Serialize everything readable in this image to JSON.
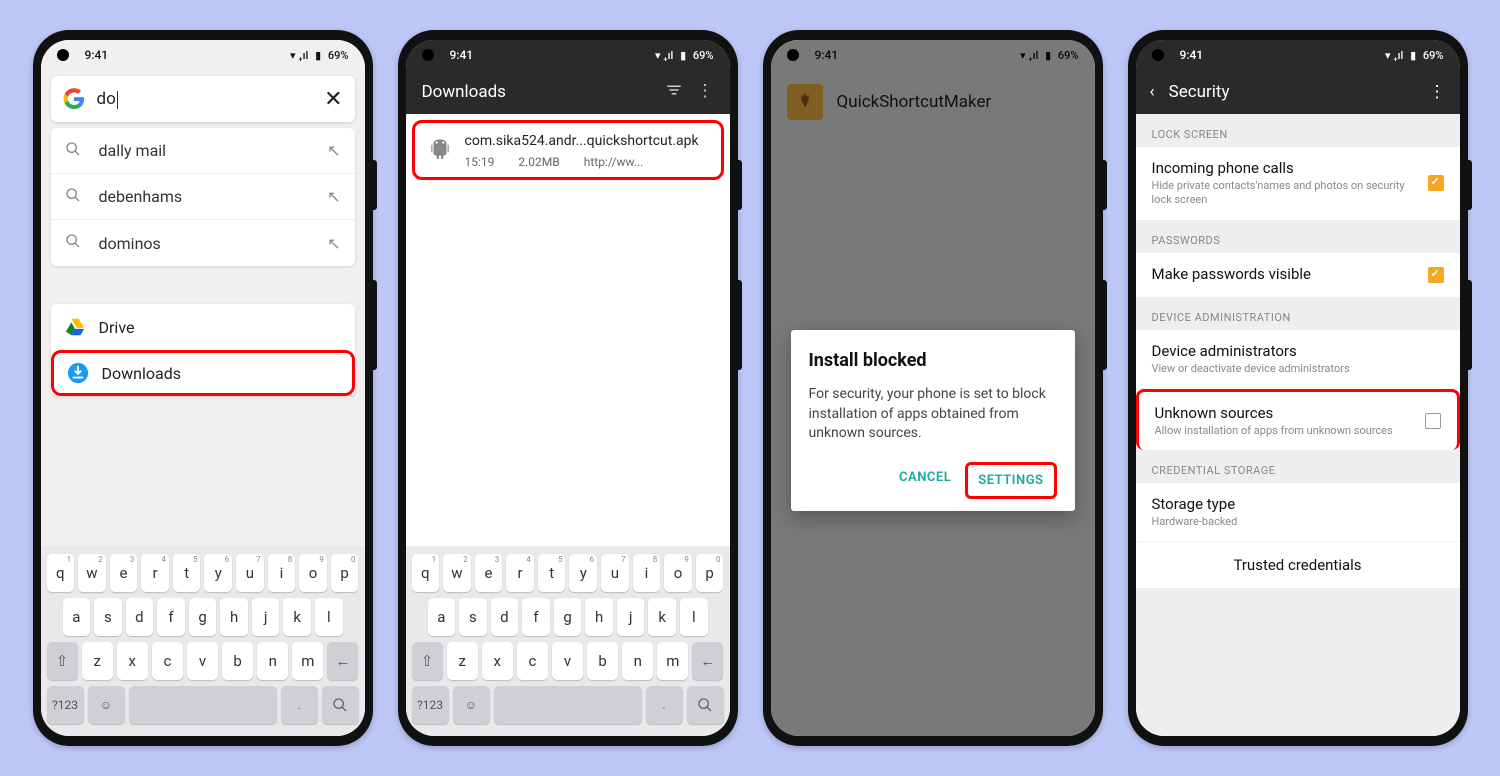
{
  "status": {
    "time": "9:41",
    "battery": "69%"
  },
  "phone1": {
    "search_query": "do",
    "suggestions": [
      {
        "text": "dally mail"
      },
      {
        "text": "debenhams"
      },
      {
        "text": "dominos"
      }
    ],
    "apps": {
      "drive": "Drive",
      "downloads": "Downloads"
    }
  },
  "keyboard": {
    "row1": [
      "q",
      "w",
      "e",
      "r",
      "t",
      "y",
      "u",
      "i",
      "o",
      "p"
    ],
    "row1sup": [
      "1",
      "2",
      "3",
      "4",
      "5",
      "6",
      "7",
      "8",
      "9",
      "0"
    ],
    "row2": [
      "a",
      "s",
      "d",
      "f",
      "g",
      "h",
      "j",
      "k",
      "l"
    ],
    "row3": [
      "z",
      "x",
      "c",
      "v",
      "b",
      "n",
      "m"
    ],
    "numkey": "?123"
  },
  "phone2": {
    "title": "Downloads",
    "file": {
      "name": "com.sika524.andr...quickshortcut.apk",
      "time": "15:19",
      "size": "2.02MB",
      "source": "http://ww..."
    }
  },
  "phone3": {
    "app_name": "QuickShortcutMaker",
    "dialog": {
      "title": "Install blocked",
      "body": "For security, your phone is set to block installation of apps obtained from unknown sources.",
      "cancel": "CANCEL",
      "settings": "SETTINGS"
    }
  },
  "phone4": {
    "title": "Security",
    "groups": {
      "lock_screen": "LOCK SCREEN",
      "passwords": "PASSWORDS",
      "device_admin": "DEVICE ADMINISTRATION",
      "cred_storage": "CREDENTIAL STORAGE"
    },
    "items": {
      "incoming": {
        "title": "Incoming phone calls",
        "sub": "Hide private contacts'names and photos on security lock screen"
      },
      "pwvisible": {
        "title": "Make passwords visible"
      },
      "devadmin": {
        "title": "Device administrators",
        "sub": "View or deactivate device administrators"
      },
      "unknown": {
        "title": "Unknown sources",
        "sub": "Allow installation of apps from unknown sources"
      },
      "storage": {
        "title": "Storage type",
        "sub": "Hardware-backed"
      },
      "trusted": {
        "title": "Trusted credentials"
      }
    }
  }
}
